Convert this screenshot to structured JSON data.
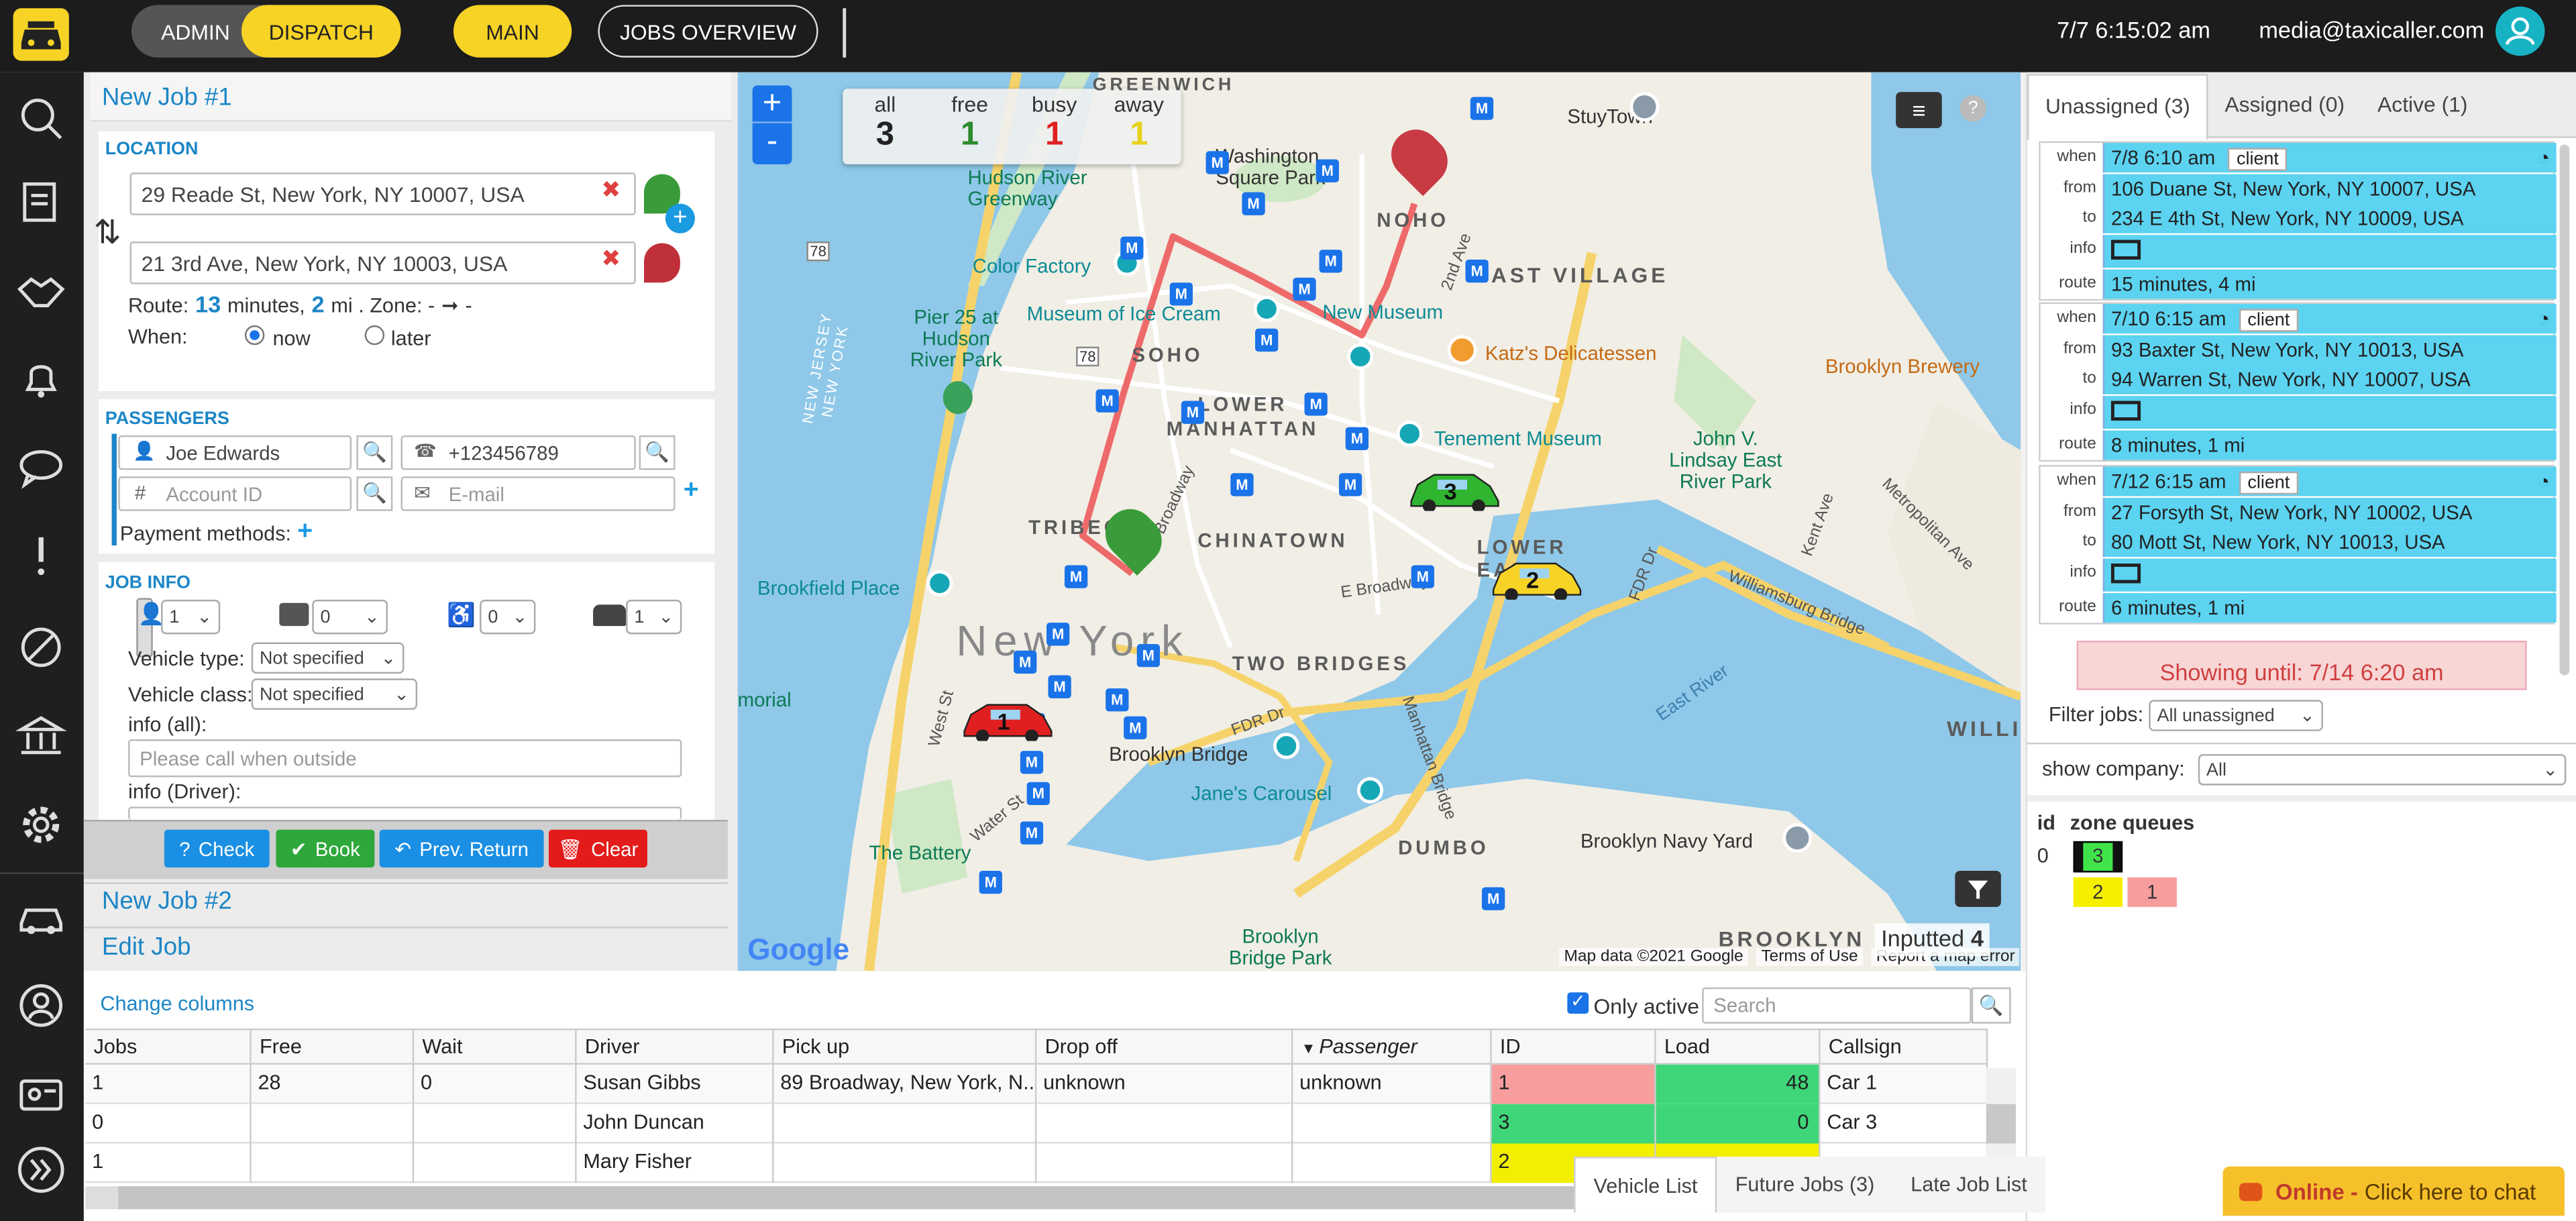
{
  "topbar": {
    "admin": "ADMIN",
    "dispatch": "DISPATCH",
    "main": "MAIN",
    "jobs_overview": "JOBS OVERVIEW",
    "datetime": "7/7 6:15:02 am",
    "user": "media@taxicaller.com"
  },
  "new_job": {
    "title": "New Job #1",
    "location_label": "LOCATION",
    "from": "29 Reade St, New York, NY 10007, USA",
    "to": "21 3rd Ave, New York, NY 10003, USA",
    "route_prefix": "Route:",
    "route_minutes": "13",
    "route_min_label": "minutes,",
    "route_mi": "2",
    "route_mi_label": "mi . Zone: -",
    "route_arrow": "➞",
    "route_zone_to": "-",
    "when_label": "When:",
    "when_now": "now",
    "when_later": "later",
    "passengers_label": "PASSENGERS",
    "passenger_name": "Joe Edwards",
    "passenger_phone": "+123456789",
    "account_placeholder": "Account ID",
    "email_placeholder": "E-mail",
    "payment_methods": "Payment methods:",
    "job_info_label": "JOB INFO",
    "count_passengers": "1",
    "count_luggage": "0",
    "count_wheelchair": "0",
    "count_vehicles": "1",
    "vehicle_type_label": "Vehicle type:",
    "vehicle_type": "Not specified",
    "vehicle_class_label": "Vehicle class:",
    "vehicle_class": "Not specified",
    "info_all_label": "info (all):",
    "info_all_placeholder": "Please call when outside",
    "info_driver_label": "info (Driver):",
    "check": "Check",
    "book": "Book",
    "prev_return": "Prev. Return",
    "clear": "Clear"
  },
  "other_jobs": {
    "job2": "New Job #2",
    "edit": "Edit Job"
  },
  "map": {
    "stats": [
      {
        "label": "all",
        "value": "3",
        "color": "#222222"
      },
      {
        "label": "free",
        "value": "1",
        "color": "#2e8b2e"
      },
      {
        "label": "busy",
        "value": "1",
        "color": "#e02020"
      },
      {
        "label": "away",
        "value": "1",
        "color": "#e6d21a"
      }
    ],
    "city": "New York",
    "labels": {
      "greenwich": "GREENWICH",
      "washington": "Washington\nSquare Park",
      "stuytown": "StuyTown",
      "noho": "NOHO",
      "east_village": "EAST VILLAGE",
      "hudson_greenway": "Hudson River\nGreenway",
      "color_factory": "Color Factory",
      "museum_ice": "Museum of Ice Cream",
      "new_museum": "New Museum",
      "katz": "Katz's Delicatessen",
      "brooklyn_brewery": "Brooklyn Brewery",
      "pier25": "Pier 25 at\nHudson\nRiver Park",
      "soho": "SOHO",
      "lower_manhattan": "LOWER\nMANHATTAN",
      "tenement": "Tenement Museum",
      "lindsay": "John V.\nLindsay East\nRiver Park",
      "tribeca": "TRIBEC",
      "chinatown": "CHINATOWN",
      "lower_east": "LOWER\nEAS",
      "brookfield": "Brookfield Place",
      "two_bridges": "TWO BRIDGES",
      "memorial": "morial",
      "brooklyn_bridge": "Brooklyn Bridge",
      "janes": "Jane's Carousel",
      "the_battery": "The Battery",
      "dumbo": "DUMBO",
      "brooklyn_navy": "Brooklyn Navy Yard",
      "brooklyn": "BROOKLYN",
      "bridge_park": "Brooklyn\nBridge Park",
      "williamsburg": "Williamsburg Bridge",
      "east_river": "East River",
      "fdr": "FDR Dr",
      "fdr2": "FDR Dr",
      "broadway": "Broadway",
      "e_broadway": "E Broadway",
      "west_st": "West St",
      "water_st": "Water St",
      "manhattan_bridge": "Manhattan Bridge",
      "kent_ave": "Kent Ave",
      "metro_ave": "Metropolitan Ave",
      "nj_ny": "NEW JERSEY\nNEW YORK",
      "second_ave": "2nd Ave",
      "williams": "WILLIA",
      "route78": "78",
      "route78b": "78"
    },
    "marker_letter": "M",
    "cars": [
      {
        "id": "1",
        "color": "#e02020"
      },
      {
        "id": "2",
        "color": "#f6d325"
      },
      {
        "id": "3",
        "color": "#2fb52f"
      }
    ],
    "attribution": "Map data ©2021 Google",
    "terms": "Terms of Use",
    "report": "Report a map error",
    "inputted_label": "Inputted",
    "inputted_value": "4",
    "google": "Google"
  },
  "right": {
    "tabs": [
      {
        "label": "Unassigned (3)"
      },
      {
        "label": "Assigned (0)"
      },
      {
        "label": "Active (1)"
      }
    ],
    "jobs": [
      {
        "when": "7/8 6:10 am",
        "tag": "client",
        "from": "106 Duane St, New York, NY 10007, USA",
        "to": "234 E 4th St, New York, NY 10009, USA",
        "route": "15 minutes, 4 mi"
      },
      {
        "when": "7/10 6:15 am",
        "tag": "client",
        "from": "93 Baxter St, New York, NY 10013, USA",
        "to": "94 Warren St, New York, NY 10007, USA",
        "route": "8 minutes, 1 mi"
      },
      {
        "when": "7/12 6:15 am",
        "tag": "client",
        "from": "27 Forsyth St, New York, NY 10002, USA",
        "to": "80 Mott St, New York, NY 10013, USA",
        "route": "6 minutes, 1 mi"
      }
    ],
    "keys": {
      "when": "when",
      "from": "from",
      "to": "to",
      "info": "info",
      "route": "route"
    },
    "showing_until": "Showing until: 7/14 6:20 am",
    "filter_label": "Filter jobs:",
    "filter_value": "All unassigned",
    "company_label": "show company:",
    "company_value": "All",
    "zone_id_header": "id",
    "zone_header": "zone queues",
    "zone_row_id": "0",
    "zone_cells": [
      "3",
      "2",
      "1"
    ]
  },
  "table": {
    "change_columns": "Change columns",
    "only_active": "Only active",
    "search_placeholder": "Search",
    "headers": [
      "Jobs",
      "Free",
      "Wait",
      "Driver",
      "Pick up",
      "Drop off",
      "Passenger",
      "ID",
      "Load",
      "Callsign"
    ],
    "rows": [
      {
        "jobs": "1",
        "free": "28",
        "wait": "0",
        "driver": "Susan Gibbs",
        "pickup": "89 Broadway, New York, N...",
        "dropoff": "unknown",
        "passenger": "unknown",
        "id": "1",
        "id_color": "#f79d9d",
        "load": "48",
        "load_color": "#3fd67a",
        "callsign": "Car 1"
      },
      {
        "jobs": "0",
        "free": "",
        "wait": "",
        "driver": "John Duncan",
        "pickup": "",
        "dropoff": "",
        "passenger": "",
        "id": "3",
        "id_color": "#3fd67a",
        "load": "0",
        "load_color": "#3fd67a",
        "callsign": "Car 3"
      },
      {
        "jobs": "1",
        "free": "",
        "wait": "",
        "driver": "Mary Fisher",
        "pickup": "",
        "dropoff": "",
        "passenger": "",
        "id": "2",
        "id_color": "#f2f000",
        "load": "",
        "load_color": "#f2f000",
        "callsign": ""
      }
    ],
    "bottom_tabs": [
      "Vehicle List",
      "Future Jobs (3)",
      "Late Job List"
    ]
  },
  "chat": {
    "online": "Online -",
    "text": "Click here to chat"
  }
}
